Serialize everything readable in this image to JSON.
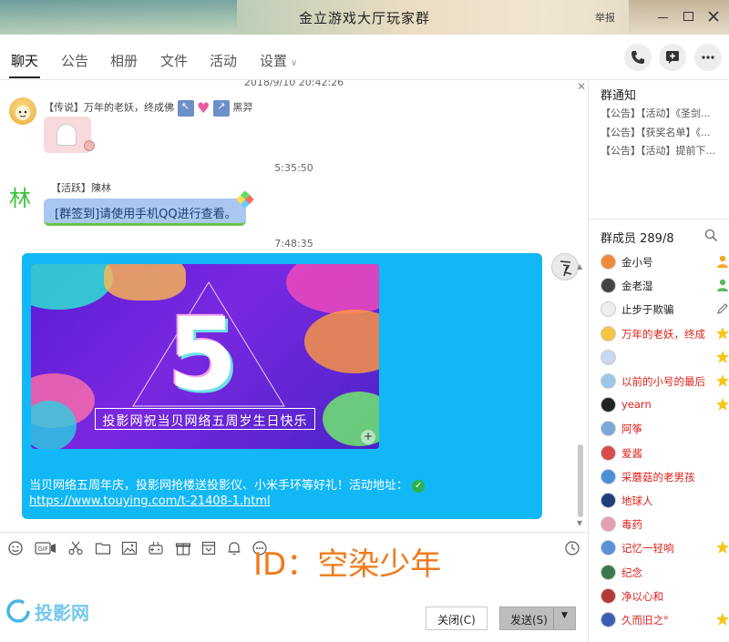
{
  "window": {
    "title": "金立游戏大厅玩家群",
    "report_label": "举报"
  },
  "tabs": [
    {
      "label": "聊天"
    },
    {
      "label": "公告"
    },
    {
      "label": "相册"
    },
    {
      "label": "文件"
    },
    {
      "label": "活动"
    },
    {
      "label": "设置"
    }
  ],
  "chat": {
    "messages": [
      {
        "time": "2018/9/10 20:42:26",
        "sender": "【传说】万年的老妖，终成佛",
        "sender_suffix": "黑羿"
      },
      {
        "time": "5:35:50",
        "sender": "【活跃】陳林",
        "avatar_text": "林",
        "text": "[群签到]请使用手机QQ进行查看。"
      },
      {
        "time": "7:48:35",
        "promo_text": "投影网祝当贝网络五周岁生日快乐",
        "promo_number": "5",
        "caption": "当贝网络五周年庆，投影网抢楼送投影仪、小米手环等好礼！活动地址：",
        "link": "https://www.touying.com/t-21408-1.html"
      }
    ]
  },
  "watermark": "ID：空染少年",
  "logo_text": "投影网",
  "buttons": {
    "close": "关闭(C)",
    "send": "发送(S)"
  },
  "notices": {
    "title": "群通知",
    "items": [
      "【公告】【活动】《圣剑...",
      "【公告】【获奖名单】《...",
      "【公告】【活动】提前下..."
    ]
  },
  "members": {
    "title": "群成员 289/8",
    "list": [
      {
        "name": "金小号",
        "color": "#222222",
        "badge": "owner"
      },
      {
        "name": "金老湿",
        "color": "#222222",
        "badge": "admin"
      },
      {
        "name": "止步于欺骗",
        "color": "#222222",
        "badge": "edit"
      },
      {
        "name": "万年的老妖，终成佛",
        "color": "#e0201b",
        "badge": "star"
      },
      {
        "name": "",
        "color": "#e0201b",
        "badge": "star"
      },
      {
        "name": "以前的小号的最后",
        "color": "#e0201b",
        "badge": "star"
      },
      {
        "name": "yearn",
        "color": "#e0201b",
        "badge": "star"
      },
      {
        "name": "阿筝",
        "color": "#e0201b",
        "badge": ""
      },
      {
        "name": "爱酱",
        "color": "#e0201b",
        "badge": ""
      },
      {
        "name": "采蘑菇的老男孩",
        "color": "#e0201b",
        "badge": ""
      },
      {
        "name": "地球人",
        "color": "#e0201b",
        "badge": ""
      },
      {
        "name": "毒药",
        "color": "#e0201b",
        "badge": ""
      },
      {
        "name": "记忆一轻响",
        "color": "#e0201b",
        "badge": "star"
      },
      {
        "name": "纪念",
        "color": "#e0201b",
        "badge": ""
      },
      {
        "name": "净以心和",
        "color": "#e0201b",
        "badge": ""
      },
      {
        "name": "久而旧之°",
        "color": "#e0201b",
        "badge": "star"
      }
    ]
  }
}
